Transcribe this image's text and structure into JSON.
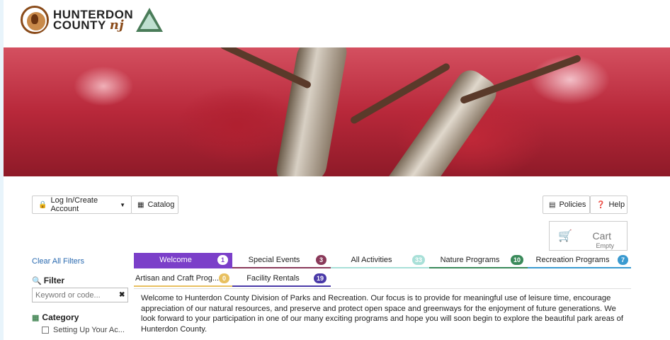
{
  "header": {
    "logo_line1": "HUNTERDON",
    "logo_line2": "COUNTY",
    "logo_script": "nj"
  },
  "toolbar": {
    "login_label": "Log In/Create Account",
    "catalog_label": "Catalog",
    "policies_label": "Policies",
    "help_label": "Help"
  },
  "cart": {
    "label": "Cart",
    "status": "Empty"
  },
  "sidebar": {
    "clear_label": "Clear All Filters",
    "filter_heading": "Filter",
    "keyword_placeholder": "Keyword or code...",
    "category_heading": "Category",
    "category_items": [
      "Setting Up Your Ac..."
    ]
  },
  "tabs": [
    {
      "label": "Welcome",
      "count": "1",
      "color": "#7b3fc9",
      "active": true
    },
    {
      "label": "Special Events",
      "count": "3",
      "color": "#8a3a5a"
    },
    {
      "label": "All Activities",
      "count": "33",
      "color": "#a8e0d8"
    },
    {
      "label": "Nature Programs",
      "count": "10",
      "color": "#3a8a5a"
    },
    {
      "label": "Recreation Programs",
      "count": "7",
      "color": "#3a9ad0"
    },
    {
      "label": "Artisan and Craft Prog...",
      "count": "0",
      "color": "#e8c060"
    },
    {
      "label": "Facility Rentals",
      "count": "19",
      "color": "#4a3aa8"
    }
  ],
  "welcome_text": "Welcome to Hunterdon County Division of Parks and Recreation. Our focus is to provide for meaningful use of leisure time, encourage appreciation of our natural resources, and preserve and protect open space and greenways for the enjoyment of future generations. We look forward to your participation in one of our many exciting programs and hope you will soon begin to explore the beautiful park areas of Hunterdon County."
}
